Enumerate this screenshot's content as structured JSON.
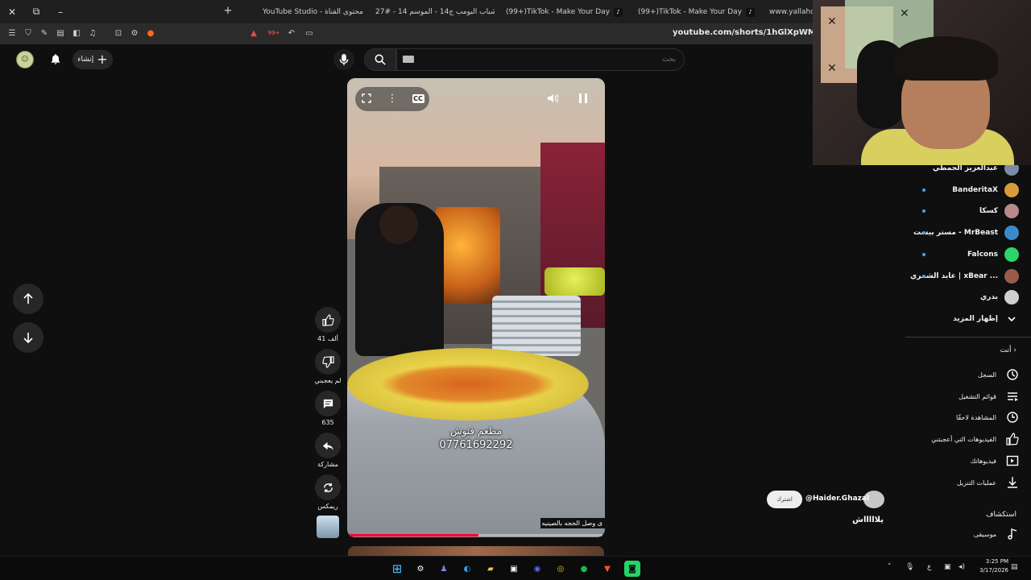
{
  "browser": {
    "tabs": [
      {
        "label": "YouTube Studio - محتوى القناة",
        "icon_color": "#ff0033"
      },
      {
        "label": "شباب البومب ج14 - الموسم 14 - #27",
        "icon_color": "#e0a800"
      },
      {
        "label": "(99+)TikTok - Make Your Day",
        "icon_color": "#111111"
      },
      {
        "label": "(99+)TikTok - Make Your Day",
        "icon_color": "#111111"
      },
      {
        "label": "www.yallahoo.c",
        "icon_color": "#444444"
      }
    ],
    "url": "youtube.com/shorts/1hGlXpWMdAM",
    "badge": "99+"
  },
  "header": {
    "create_label": "إنشاء",
    "search_placeholder": "بحث"
  },
  "video": {
    "overlay_name": "مطعم فنوش",
    "overlay_phone": "07761692292",
    "caption": "ى وصل الحجه بالصينيه",
    "progress": 0.51
  },
  "actions": {
    "like_count": "41 ألف",
    "dislike_label": "لم يعجبني",
    "comment_count": "635",
    "share_label": "مشاركة",
    "remix_label": "ريمكس"
  },
  "subscriptions": [
    {
      "name": "عبدالعزيز الحمطي",
      "avatar_color": "#7a8aa8",
      "dot": false
    },
    {
      "name": "BanderitaX",
      "avatar_color": "#d89a3a",
      "dot": true
    },
    {
      "name": "كسكا",
      "avatar_color": "#b88a8a",
      "dot": true
    },
    {
      "name": "مستر بيست - MrBeast",
      "avatar_color": "#3a8ac8",
      "dot": true
    },
    {
      "name": "Falcons",
      "avatar_color": "#2bd56a",
      "dot": true
    },
    {
      "name": "عابد الشمري | xBear ...",
      "avatar_color": "#9a5a4a",
      "dot": true
    },
    {
      "name": "بدري",
      "avatar_color": "#cfcfcf",
      "dot": false
    },
    {
      "name": "إظهار المزيد",
      "avatar_color": "",
      "dot": false
    }
  ],
  "you_section": {
    "heading": "أنت",
    "items": [
      {
        "label": "السجل",
        "icon": "history-icon"
      },
      {
        "label": "قوائم التشغيل",
        "icon": "playlists-icon"
      },
      {
        "label": "المشاهدة لاحقًا",
        "icon": "watch-later-icon"
      },
      {
        "label": "الفيديوهات التي أعجبتني",
        "icon": "liked-icon"
      },
      {
        "label": "فيديوهاتك",
        "icon": "your-videos-icon"
      },
      {
        "label": "عمليات التنزيل",
        "icon": "downloads-icon"
      }
    ]
  },
  "explore": {
    "heading": "استكشاف",
    "items": [
      {
        "label": "موسيقى",
        "icon": "music-icon"
      }
    ]
  },
  "live_comment": {
    "user": "@Haider.Ghazal",
    "badge": "اشترك",
    "text": "يلاااااش"
  },
  "taskbar": {
    "time": "3:25 PM",
    "date": "3/17/2026",
    "lang": "ع"
  },
  "colors": {
    "background": "#0f0f0f",
    "accent_red": "#ff0033",
    "subscription_dot": "#3ea6ff"
  }
}
